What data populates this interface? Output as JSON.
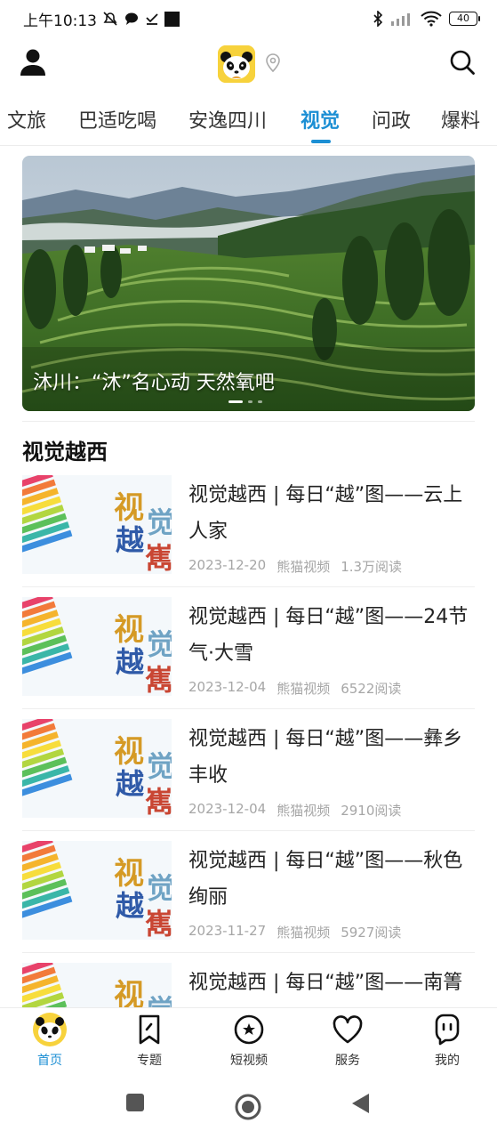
{
  "status_bar": {
    "time": "上午10:13",
    "battery": "40"
  },
  "app_bar": {
    "logo_icon": "panda-logo-icon",
    "user_icon": "user-icon",
    "location_icon": "location-pin-icon",
    "search_icon": "search-icon"
  },
  "tabs": [
    {
      "label": "文旅",
      "active": false
    },
    {
      "label": "巴适吃喝",
      "active": false
    },
    {
      "label": "安逸四川",
      "active": false
    },
    {
      "label": "视觉",
      "active": true
    },
    {
      "label": "问政",
      "active": false
    },
    {
      "label": "爆料",
      "active": false
    }
  ],
  "banner": {
    "caption": "沐川：“沐”名心动 天然氧吧",
    "slide_index": 1,
    "slide_count": 3
  },
  "section": {
    "title": "视觉越西"
  },
  "articles": [
    {
      "title": "视觉越西 | 每日“越”图——云上人家",
      "date": "2023-12-20",
      "source": "熊猫视频",
      "reads": "1.3万阅读"
    },
    {
      "title": "视觉越西 | 每日“越”图——24节气·大雪",
      "date": "2023-12-04",
      "source": "熊猫视频",
      "reads": "6522阅读"
    },
    {
      "title": "视觉越西 | 每日“越”图——彝乡丰收",
      "date": "2023-12-04",
      "source": "熊猫视频",
      "reads": "2910阅读"
    },
    {
      "title": "视觉越西 | 每日“越”图——秋色绚丽",
      "date": "2023-11-27",
      "source": "熊猫视频",
      "reads": "5927阅读"
    },
    {
      "title": "视觉越西 | 每日“越”图——南箐村航空之游",
      "date": "",
      "source": "",
      "reads": ""
    }
  ],
  "thumb_text": {
    "left_top": "视",
    "left_bottom": "越",
    "right_top": "觉",
    "right_bottom": "嶲"
  },
  "bottom_nav": [
    {
      "label": "首页",
      "icon": "panda-home-icon",
      "active": true
    },
    {
      "label": "专题",
      "icon": "bookmark-icon",
      "active": false
    },
    {
      "label": "短视频",
      "icon": "video-play-icon",
      "active": false
    },
    {
      "label": "服务",
      "icon": "heart-icon",
      "active": false
    },
    {
      "label": "我的",
      "icon": "profile-face-icon",
      "active": false
    }
  ],
  "colors": {
    "accent": "#1c8fd4",
    "text": "#222222",
    "meta": "#a6a6a6"
  }
}
